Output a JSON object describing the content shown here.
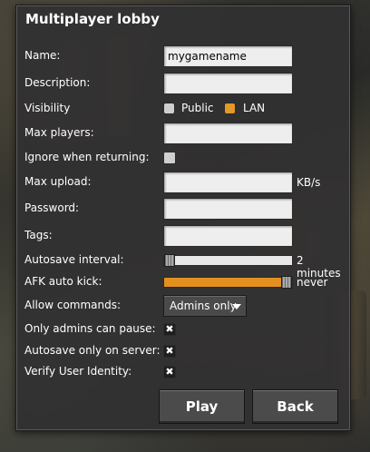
{
  "dialog": {
    "title": "Multiplayer lobby",
    "name_label": "Name:",
    "name_value": "mygamename",
    "description_label": "Description:",
    "description_value": "",
    "visibility_label": "Visibility",
    "visibility_options": [
      {
        "label": "Public",
        "selected": false
      },
      {
        "label": "LAN",
        "selected": true
      }
    ],
    "max_players_label": "Max players:",
    "max_players_value": "",
    "ignore_label": "Ignore when returning:",
    "ignore_checked": false,
    "max_upload_label": "Max upload:",
    "max_upload_value": "",
    "max_upload_unit": "KB/s",
    "password_label": "Password:",
    "password_value": "",
    "tags_label": "Tags:",
    "tags_value": "",
    "autosave_label": "Autosave interval:",
    "autosave_value_text": "2 minutes",
    "autosave_slider_fraction": 0.0,
    "afk_label": "AFK auto kick:",
    "afk_value_text": "never",
    "afk_slider_fraction": 1.0,
    "allow_commands_label": "Allow commands:",
    "allow_commands_value": "Admins only",
    "only_admins_pause_label": "Only admins can pause:",
    "only_admins_pause_checked": true,
    "autosave_server_label": "Autosave only on server:",
    "autosave_server_checked": true,
    "verify_identity_label": "Verify User Identity:",
    "verify_identity_checked": true,
    "play_button": "Play",
    "back_button": "Back",
    "check_mark": "✖"
  },
  "colors": {
    "accent": "#e3901f",
    "panel": "#313031",
    "field": "#eeeeee",
    "text": "#ffffff"
  }
}
